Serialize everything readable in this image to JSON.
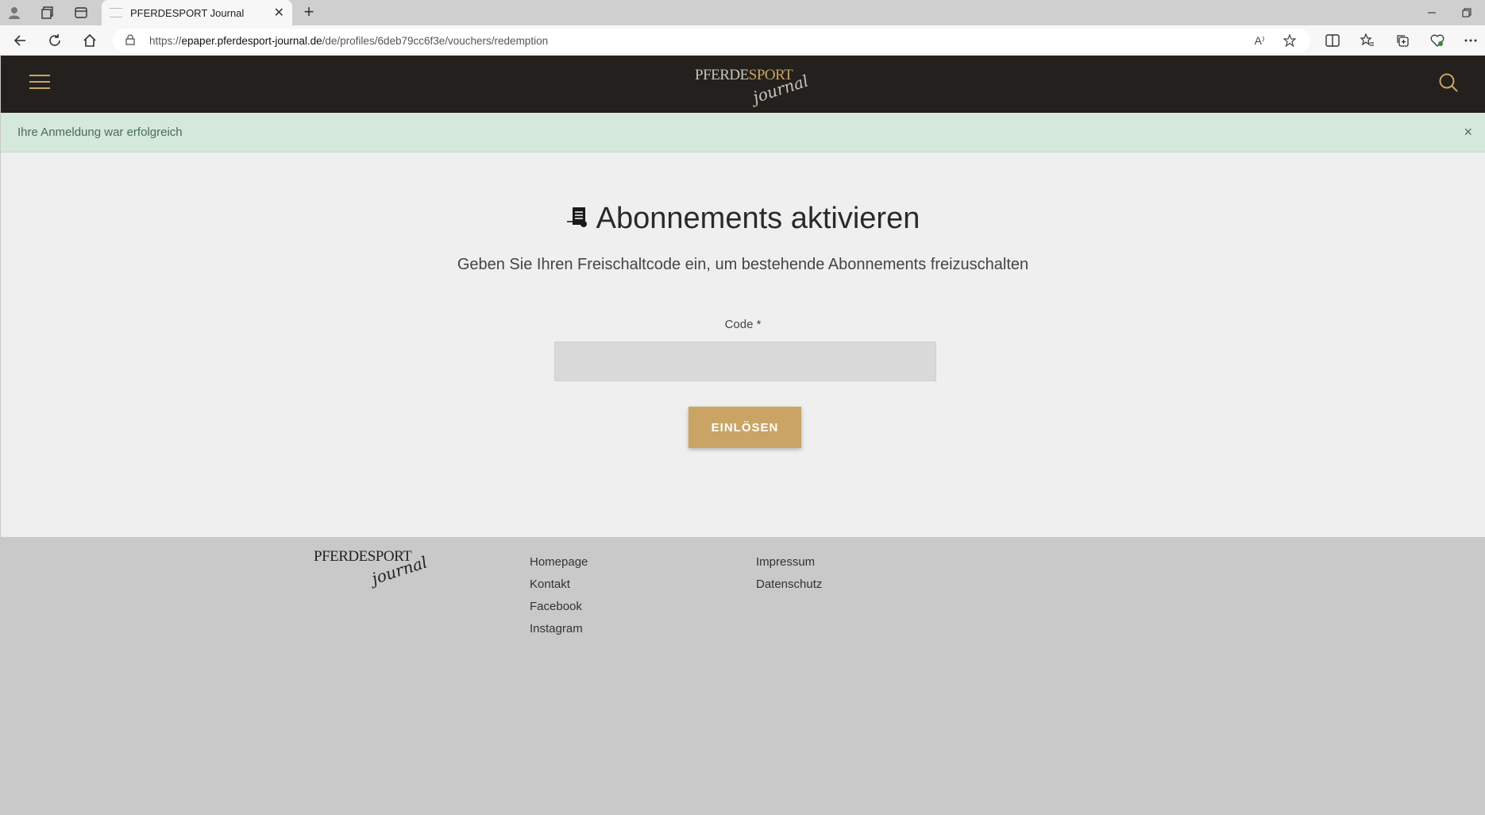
{
  "browser": {
    "tab_title": "PFERDESPORT Journal",
    "tab_close": "✕",
    "new_tab": "+",
    "url_scheme": "https://",
    "url_host": "epaper.pferdesport-journal.de",
    "url_path": "/de/profiles/6deb79cc6f3e/vouchers/redemption",
    "read_aloud": "A⁾"
  },
  "header": {
    "logo_main_dark": "PFERDE",
    "logo_main_gold": "SPORT",
    "logo_script": "journal"
  },
  "alert": {
    "message": "Ihre Anmeldung war erfolgreich",
    "close": "×"
  },
  "main": {
    "title": "Abonnements aktivieren",
    "subtitle": "Geben Sie Ihren Freischaltcode ein, um bestehende Abonnements freizuschalten",
    "code_label": "Code *",
    "code_value": "",
    "submit_label": "EINLÖSEN"
  },
  "footer": {
    "logo_main": "PFERDESPORT",
    "logo_script": "journal",
    "col1": [
      "Homepage",
      "Kontakt",
      "Facebook",
      "Instagram"
    ],
    "col2": [
      "Impressum",
      "Datenschutz"
    ]
  },
  "colors": {
    "header_bg": "#24201d",
    "accent_gold": "#c9a464",
    "alert_bg": "#d4e9dc",
    "main_bg": "#efefef",
    "footer_bg": "#c9c9c9"
  }
}
